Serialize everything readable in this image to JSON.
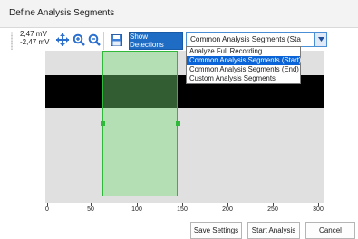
{
  "window": {
    "title": "Define Analysis Segments"
  },
  "toolbar": {
    "mv_top": "2,47 mV",
    "mv_bottom": "-2,47 mV",
    "show_detections_label": "Show Detections",
    "combo_value": "Common Analysis Segments (Sta"
  },
  "dropdown": {
    "options": [
      "Analyze Full Recording",
      "Common Analysis Segments (Start)",
      "Common Analysis Segments (End)",
      "Custom Analysis Segments"
    ],
    "selected_index": 1
  },
  "plot": {
    "x_ticks": [
      "0",
      "50",
      "100",
      "150",
      "200",
      "250",
      "300"
    ]
  },
  "buttons": {
    "save_settings": "Save Settings",
    "start_analysis": "Start Analysis",
    "cancel": "Cancel"
  },
  "icons": [
    "pan-icon",
    "zoom-in-icon",
    "zoom-out-icon",
    "save-icon",
    "chevron-down-icon"
  ],
  "colors": {
    "accent": "#1f6cc5",
    "selection": "#2fb83a",
    "dropdown_selected": "#0a64d8"
  }
}
